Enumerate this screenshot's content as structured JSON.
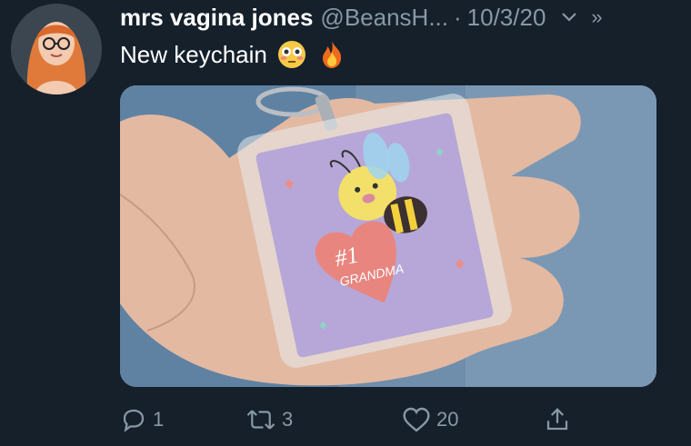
{
  "user": {
    "display_name": "mrs vagina jones",
    "handle": "@BeansH...",
    "separator": "·",
    "date": "10/3/20"
  },
  "tweet": {
    "text": "New keychain",
    "emojis": [
      "flushed-face",
      "fire"
    ]
  },
  "media": {
    "keychain_text": "#1",
    "keychain_subtext": "GRANDMA"
  },
  "actions": {
    "reply_count": "1",
    "retweet_count": "3",
    "like_count": "20"
  },
  "icons": {
    "more": "chevron-down-icon",
    "overflow": "double-chevron-icon"
  },
  "colors": {
    "background": "#15202b",
    "muted": "#8899a6",
    "text": "#ffffff"
  }
}
